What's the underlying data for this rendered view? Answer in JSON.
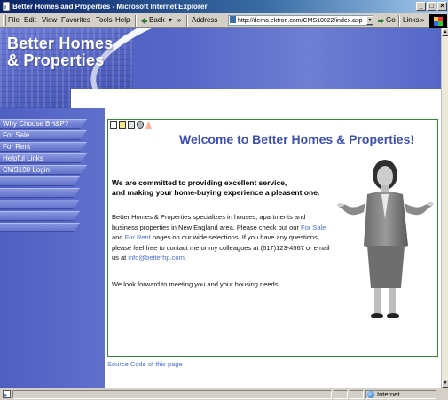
{
  "window": {
    "title": "Better Homes and Properties - Microsoft Internet Explorer",
    "controls": [
      "_",
      "□",
      "×"
    ]
  },
  "menu": {
    "items": [
      "File",
      "Edit",
      "View",
      "Favorites",
      "Tools",
      "Help"
    ],
    "back_label": "Back",
    "chevron": "»",
    "address_label": "Address",
    "address_value": "http://demo.ektron.com/CMS10022/index.asp",
    "go_label": "Go",
    "links_label": "Links"
  },
  "site": {
    "logo_line1": "Better Homes",
    "logo_line2": "& Properties",
    "nav": [
      "Why Choose BH&P?",
      "For Sale",
      "For Rent",
      "Helpful Links",
      "CMS100 Login"
    ],
    "welcome": "Welcome to Better Homes & Properties!",
    "tagline_line1": "We are committed to providing excellent service,",
    "tagline_line2": "and making your home-buying experience a pleasent one.",
    "para1_a": "Better Homes & Properties specializes in houses, apartments and business properties in New England area.  Please check out our ",
    "link_for_sale": "For Sale",
    "para1_b": " and ",
    "link_for_rent": "For Rent",
    "para1_c": " pages on our wide selections.  If you have any questions, please feel free to contact me or my colleagues at (617)123-4567 or email us at ",
    "email": "info@betterhp.com",
    "para1_d": ".",
    "para2": "We look forward to meeting you and your housing needs.",
    "source_link": "Source Code of this page"
  },
  "status": {
    "zone": "Internet"
  },
  "colors": {
    "brand_blue": "#5566c8",
    "heading_blue": "#3e4fb4",
    "link_blue": "#4a6fd0",
    "frame_green": "#2e8b2e"
  },
  "icons": [
    "ie-page-icon",
    "back-arrow-icon",
    "address-page-icon",
    "go-arrow-icon",
    "ie-logo-icon",
    "edit-icon",
    "globe-icon"
  ]
}
